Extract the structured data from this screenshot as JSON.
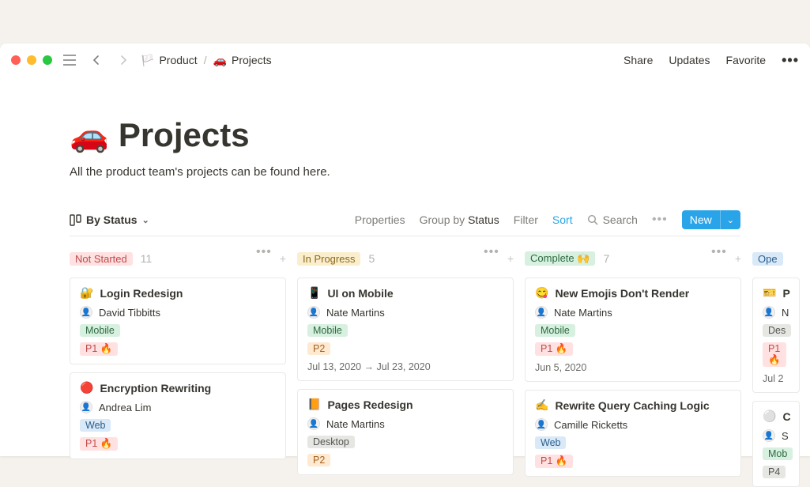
{
  "titlebar": {
    "breadcrumbs": [
      {
        "icon": "🏳️",
        "label": "Product"
      },
      {
        "icon": "🚗",
        "label": "Projects"
      }
    ],
    "right": {
      "share": "Share",
      "updates": "Updates",
      "favorite": "Favorite"
    }
  },
  "page": {
    "emoji": "🚗",
    "title": "Projects",
    "subtitle": "All the product team's projects can be found here."
  },
  "db": {
    "view_label": "By Status",
    "toolbar": {
      "properties": "Properties",
      "group_prefix": "Group by ",
      "group_value": "Status",
      "filter": "Filter",
      "sort": "Sort",
      "search": "Search",
      "new": "New"
    }
  },
  "columns": [
    {
      "status": "Not Started",
      "pill": "pink",
      "count": "11",
      "cards": [
        {
          "emoji": "🔐",
          "title": "Login Redesign",
          "assignee": "David Tibbitts",
          "tags": [
            {
              "t": "Mobile",
              "cls": "tag-mobile"
            }
          ],
          "priority": {
            "t": "P1 🔥",
            "cls": "tag-p1"
          }
        },
        {
          "emoji": "🔴",
          "title": "Encryption Rewriting",
          "assignee": "Andrea Lim",
          "tags": [
            {
              "t": "Web",
              "cls": "tag-web"
            }
          ],
          "priority": {
            "t": "P1 🔥",
            "cls": "tag-p1"
          }
        }
      ]
    },
    {
      "status": "In Progress",
      "pill": "yellow",
      "count": "5",
      "cards": [
        {
          "emoji": "📱",
          "title": "UI on Mobile",
          "assignee": "Nate Martins",
          "tags": [
            {
              "t": "Mobile",
              "cls": "tag-mobile"
            }
          ],
          "priority": {
            "t": "P2",
            "cls": "tag-p2"
          },
          "date": "Jul 13, 2020 → Jul 23, 2020"
        },
        {
          "emoji": "📙",
          "title": "Pages Redesign",
          "assignee": "Nate Martins",
          "tags": [
            {
              "t": "Desktop",
              "cls": "tag-desktop"
            }
          ],
          "priority": {
            "t": "P2",
            "cls": "tag-p2"
          }
        }
      ]
    },
    {
      "status": "Complete 🙌",
      "pill": "green",
      "count": "7",
      "cards": [
        {
          "emoji": "😋",
          "title": "New Emojis Don't Render",
          "assignee": "Nate Martins",
          "tags": [
            {
              "t": "Mobile",
              "cls": "tag-mobile"
            }
          ],
          "priority": {
            "t": "P1 🔥",
            "cls": "tag-p1"
          },
          "date": "Jun 5, 2020"
        },
        {
          "emoji": "✍️",
          "title": "Rewrite Query Caching Logic",
          "assignee": "Camille Ricketts",
          "tags": [
            {
              "t": "Web",
              "cls": "tag-web"
            }
          ],
          "priority": {
            "t": "P1 🔥",
            "cls": "tag-p1"
          }
        }
      ]
    },
    {
      "status": "Ope",
      "pill": "blue",
      "count": "",
      "cards": [
        {
          "emoji": "🎫",
          "title": "P",
          "assignee": "N",
          "tags": [
            {
              "t": "Des",
              "cls": "tag-desktop"
            }
          ],
          "priority": {
            "t": "P1 🔥",
            "cls": "tag-p1"
          },
          "date": "Jul 2"
        },
        {
          "emoji": "⚪",
          "title": "C",
          "assignee": "S",
          "tags": [
            {
              "t": "Mob",
              "cls": "tag-mobile"
            }
          ],
          "priority": {
            "t": "P4",
            "cls": "tag-p4"
          }
        }
      ]
    }
  ]
}
